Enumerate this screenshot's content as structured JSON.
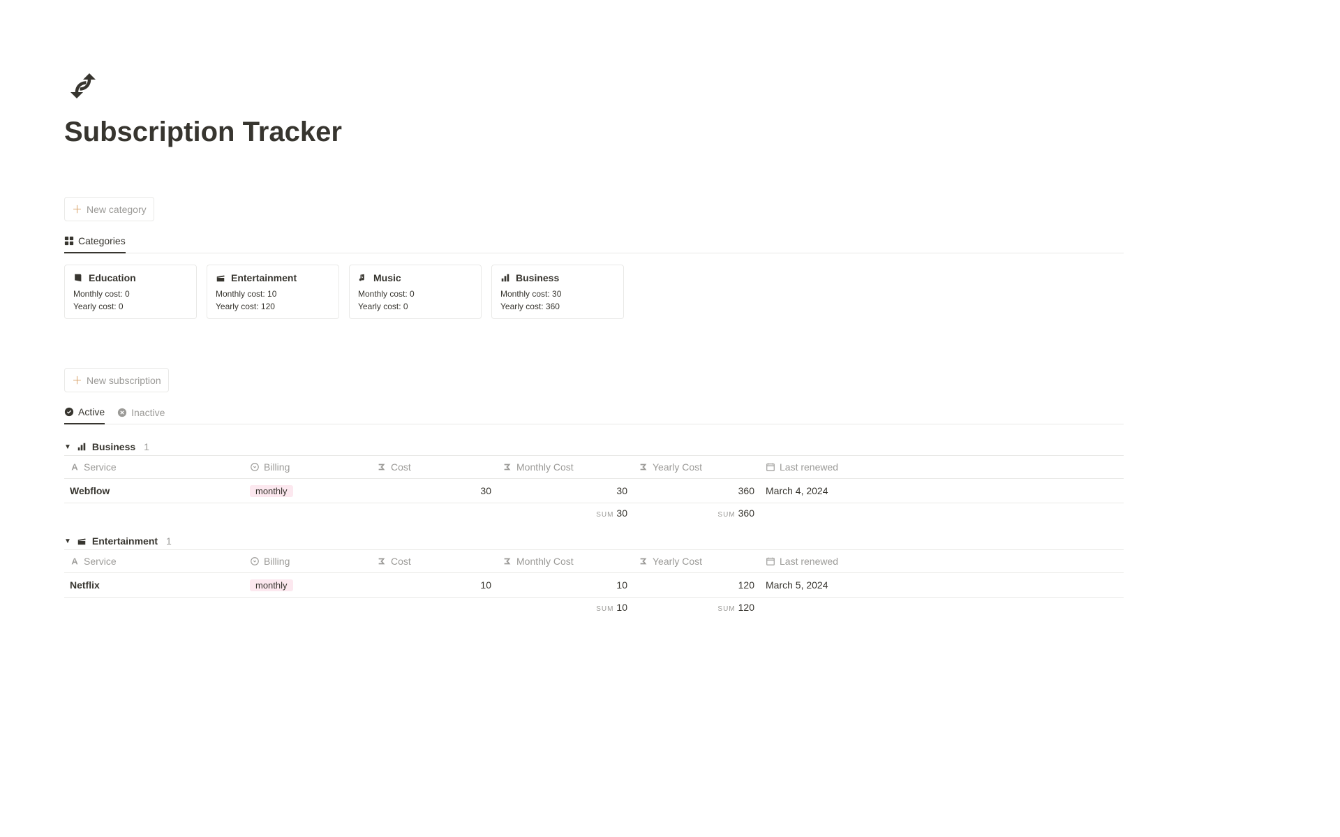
{
  "page_title": "Subscription Tracker",
  "buttons": {
    "new_category": "New category",
    "new_subscription": "New subscription"
  },
  "tabs": {
    "categories": "Categories",
    "active": "Active",
    "inactive": "Inactive"
  },
  "category_cards": [
    {
      "icon": "book",
      "name": "Education",
      "monthly": "Monthly cost: 0",
      "yearly": "Yearly cost: 0"
    },
    {
      "icon": "clapper",
      "name": "Entertainment",
      "monthly": "Monthly cost: 10",
      "yearly": "Yearly cost: 120"
    },
    {
      "icon": "music",
      "name": "Music",
      "monthly": "Monthly cost: 0",
      "yearly": "Yearly cost: 0"
    },
    {
      "icon": "chart",
      "name": "Business",
      "monthly": "Monthly cost: 30",
      "yearly": "Yearly cost: 360"
    }
  ],
  "columns": {
    "service": "Service",
    "billing": "Billing",
    "cost": "Cost",
    "monthly_cost": "Monthly Cost",
    "yearly_cost": "Yearly Cost",
    "last_renewed": "Last renewed"
  },
  "sum_label": "SUM",
  "groups": [
    {
      "icon": "chart",
      "name": "Business",
      "count": "1",
      "rows": [
        {
          "service": "Webflow",
          "billing": "monthly",
          "cost": "30",
          "monthly": "30",
          "yearly": "360",
          "renewed": "March 4, 2024"
        }
      ],
      "sum_monthly": "30",
      "sum_yearly": "360"
    },
    {
      "icon": "clapper",
      "name": "Entertainment",
      "count": "1",
      "rows": [
        {
          "service": "Netflix",
          "billing": "monthly",
          "cost": "10",
          "monthly": "10",
          "yearly": "120",
          "renewed": "March 5, 2024"
        }
      ],
      "sum_monthly": "10",
      "sum_yearly": "120"
    }
  ]
}
